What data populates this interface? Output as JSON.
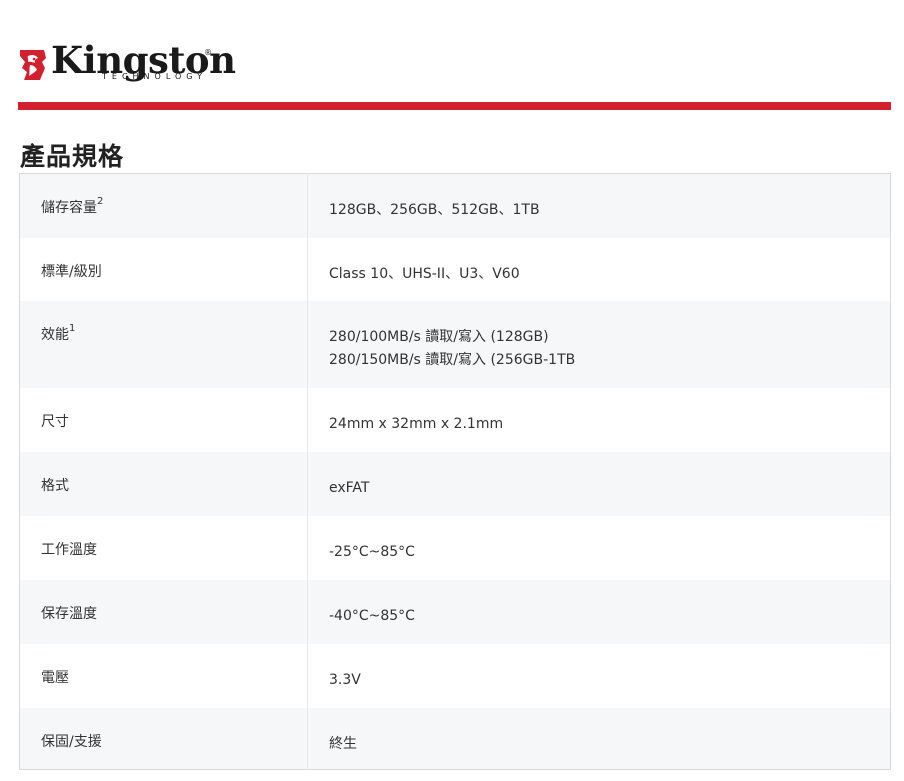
{
  "brand": {
    "wordmark": "Kingston",
    "tagline": "TECHNOLOGY",
    "registered": "®",
    "accent_color": "#d3202f"
  },
  "page": {
    "title": "產品規格"
  },
  "specs": [
    {
      "label": "儲存容量",
      "sup": "2",
      "values": [
        "128GB、256GB、512GB、1TB"
      ]
    },
    {
      "label": "標準/級別",
      "sup": "",
      "values": [
        "Class 10、UHS-II、U3、V60"
      ]
    },
    {
      "label": "效能",
      "sup": "1",
      "values": [
        "280/100MB/s 讀取/寫入 (128GB)",
        "280/150MB/s 讀取/寫入 (256GB-1TB"
      ]
    },
    {
      "label": "尺寸",
      "sup": "",
      "values": [
        "24mm x 32mm x 2.1mm"
      ]
    },
    {
      "label": "格式",
      "sup": "",
      "values": [
        "exFAT"
      ]
    },
    {
      "label": "工作溫度",
      "sup": "",
      "values": [
        "-25°C~85°C"
      ]
    },
    {
      "label": "保存溫度",
      "sup": "",
      "values": [
        "-40°C~85°C"
      ]
    },
    {
      "label": "電壓",
      "sup": "",
      "values": [
        "3.3V"
      ]
    },
    {
      "label": "保固/支援",
      "sup": "",
      "values": [
        "終生"
      ]
    }
  ]
}
